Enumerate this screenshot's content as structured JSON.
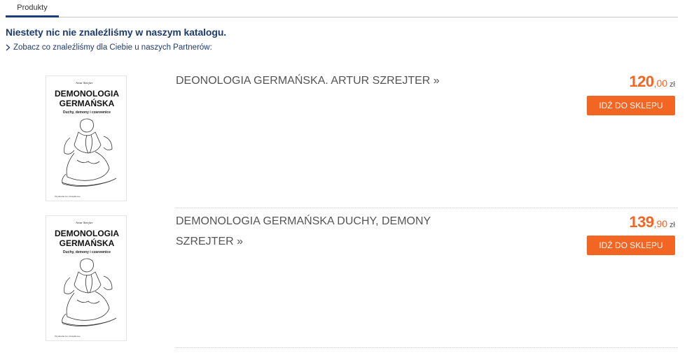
{
  "tabs": [
    {
      "label": "Produkty"
    }
  ],
  "message": "Niestety nic nie znaleźliśmy w naszym katalogu.",
  "partners_link": "Zobacz co znaleźliśmy dla Ciebie u naszych Partnerów:",
  "cover": {
    "author": "Artur Szrejter",
    "title1": "DEMONOLOGIA",
    "title2": "GERMAŃSKA",
    "subtitle": "Duchy, demony i czarownice",
    "publisher": "Wydawnictwo Książkowe"
  },
  "products": [
    {
      "title": "DEONOLOGIA GERMAŃSKA. ARTUR SZREJTER »",
      "price_int": "120",
      "price_dec": ",00",
      "currency": "zł",
      "button": "IDŹ DO SKLEPU"
    },
    {
      "title": "DEMONOLOGIA GERMAŃSKA DUCHY, DEMONY SZREJTER »",
      "price_int": "139",
      "price_dec": ",90",
      "currency": "zł",
      "button": "IDŹ DO SKLEPU"
    }
  ],
  "colors": {
    "accent": "#f26522",
    "navy": "#1f3c6e"
  }
}
